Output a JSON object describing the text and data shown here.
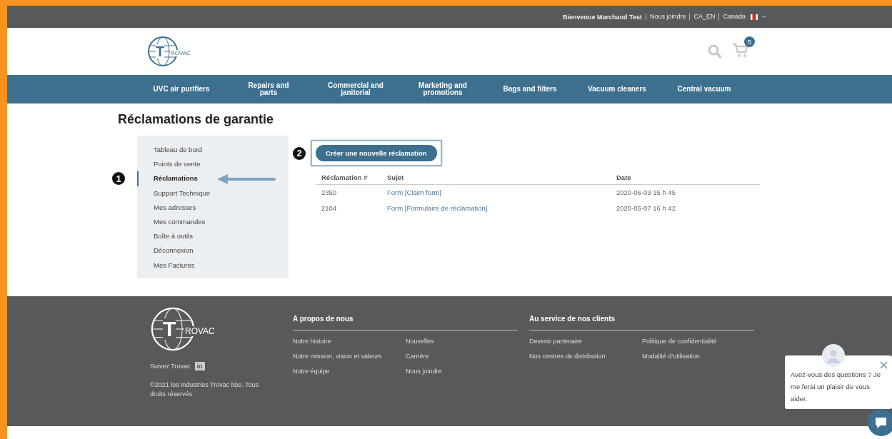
{
  "top_bar": {
    "welcome": "Bienvenue Marchand Test",
    "links": [
      "Nous joindre",
      "CA_EN",
      "Canada"
    ]
  },
  "logo": {
    "initial": "T",
    "rest": "ROVAC"
  },
  "cart": {
    "count": "5"
  },
  "nav": [
    "UVC air purifiers",
    "Repairs and parts",
    "Commercial and janitorial",
    "Marketing and promotions",
    "Bags and filters",
    "Vacuum cleaners",
    "Central vacuum"
  ],
  "page_title": "Réclamations de garantie",
  "sidebar": {
    "items": [
      {
        "label": "Tableau de bord",
        "selected": false
      },
      {
        "label": "Points de vente",
        "selected": false
      },
      {
        "label": "Réclamations",
        "selected": true
      },
      {
        "label": "Support Technique",
        "selected": false
      },
      {
        "label": "Mes adresses",
        "selected": false
      },
      {
        "label": "Mes commandes",
        "selected": false
      },
      {
        "label": "Boîte à outils",
        "selected": false
      },
      {
        "label": "Déconnexion",
        "selected": false
      },
      {
        "label": "Mes Factures",
        "selected": false
      }
    ]
  },
  "annotations": [
    "1",
    "2"
  ],
  "new_claim_button": "Créer une nouvelle réclamation",
  "table": {
    "columns": [
      "Réclamation #",
      "Sujet",
      "Date"
    ],
    "rows": [
      [
        "2350",
        "Form [Claim form]",
        "2020-06-03 15 h 45"
      ],
      [
        "2104",
        "Form [Formulaire de réclamation]",
        "2020-05-07 16 h 42"
      ]
    ]
  },
  "footer": {
    "logo": {
      "initial": "T",
      "rest": "ROVAC"
    },
    "follow": "Suivez Trovac",
    "linkedin": "in",
    "copyright": "©2021 les industries Trovac ltée. Tous droits réservés",
    "sections": [
      {
        "title": "A propos de nous",
        "links": [
          "Notre histoire",
          "Nouvelles",
          "Notre mission, vision et valeurs",
          "Carrière",
          "Notre équipe",
          "Nous joindre"
        ]
      },
      {
        "title": "Au service de nos clients",
        "links": [
          "Devenir partenaire",
          "Politique de confidentialité",
          "Nos centres de distribution",
          "Modalité d'utilisation"
        ]
      }
    ]
  },
  "chat": {
    "message": "Avez-vous des questions ? Je me ferai un plaisir de vous aider."
  }
}
